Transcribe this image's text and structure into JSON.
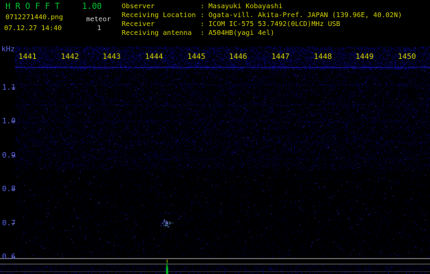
{
  "header": {
    "app_name": "H R O F F T",
    "version": "1.00",
    "filename": "0712271440.png",
    "mode_label": "meteor",
    "mode_count": "1",
    "datetime": "07.12.27 14:40",
    "separator": ":",
    "info": [
      {
        "label": "Observer",
        "value": "Masayuki Kobayashi"
      },
      {
        "label": "Receiving Location",
        "value": "Ogata-vill. Akita-Pref. JAPAN (139.96E, 40.02N)"
      },
      {
        "label": "Receiver",
        "value": "ICOM IC-575 53.7492(0LCD)MHz USB"
      },
      {
        "label": "Receiving antenna",
        "value": "A504HB(yagi 4el)"
      }
    ]
  },
  "colors": {
    "background": "#000000",
    "title_green": "#00c832",
    "text_yellow": "#d4d400",
    "text_white": "#d0d0d0",
    "axis_blue": "#5a64e6",
    "noise_blue": "#0000ff",
    "spike_green": "#00bb22",
    "spike_yellow": "#c8c800"
  },
  "chart_data": {
    "type": "heatmap",
    "title": "",
    "xlabel": "",
    "ylabel": "kHz",
    "x_ticks": [
      "1441",
      "1442",
      "1443",
      "1444",
      "1445",
      "1446",
      "1447",
      "1448",
      "1449",
      "1450"
    ],
    "y_ticks": [
      "1.1",
      "1.0",
      "0.9",
      "0.8",
      "0.7",
      "0.6"
    ],
    "ylim_khz": [
      0.6,
      1.22
    ],
    "legend": "none",
    "interference_bands": [
      {
        "khz": 1.16,
        "intensity": 0.9
      },
      {
        "khz": 1.11,
        "intensity": 0.5
      },
      {
        "khz": 1.05,
        "intensity": 0.42
      },
      {
        "khz": 1.0,
        "intensity": 0.38
      },
      {
        "khz": 0.94,
        "intensity": 0.3
      },
      {
        "khz": 0.89,
        "intensity": 0.22
      },
      {
        "khz": 0.73,
        "intensity": 0.12
      },
      {
        "khz": 0.63,
        "intensity": 0.1
      }
    ],
    "meteor_echoes": [
      {
        "time": "1444.3",
        "khz": 0.7
      }
    ],
    "level_spikes": [
      {
        "time": "1444.3"
      }
    ]
  }
}
